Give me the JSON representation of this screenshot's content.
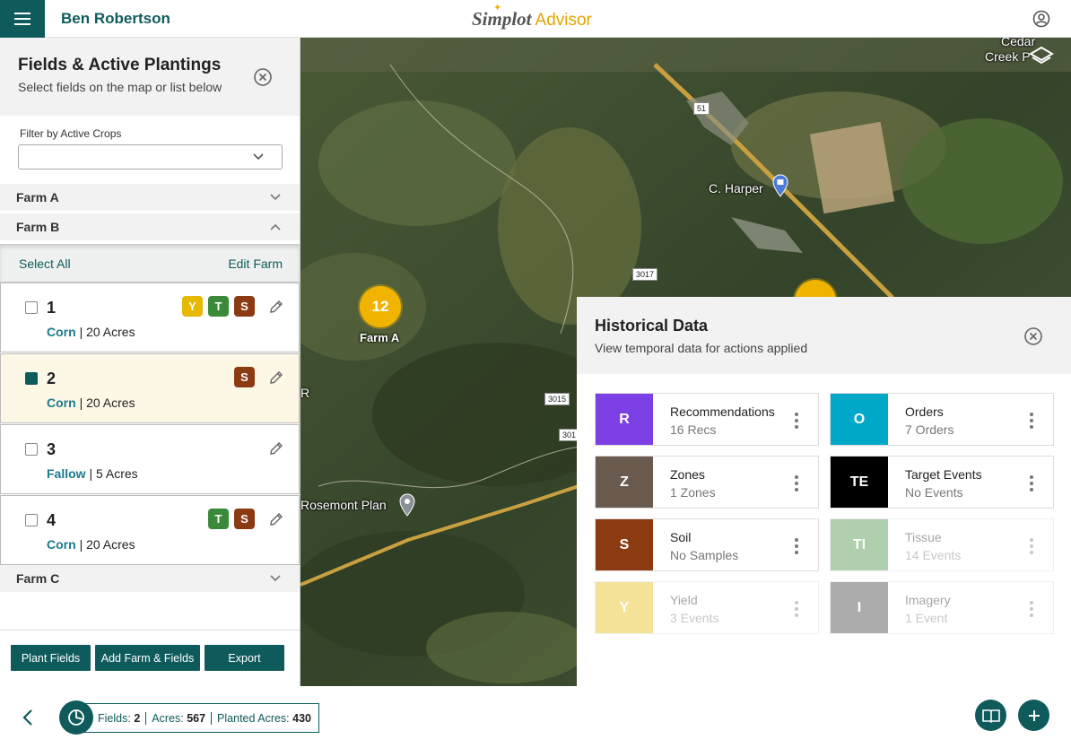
{
  "app": {
    "user_name": "Ben Robertson",
    "brand_name": "Simplot",
    "brand_product": "Advisor",
    "colors": {
      "primary": "#0f5b5c",
      "accent": "#f0b400"
    }
  },
  "fields_panel": {
    "title": "Fields & Active Plantings",
    "subtitle": "Select fields on the map or list below",
    "filter_label": "Filter by Active Crops",
    "filter_value": "",
    "farms": {
      "a": "Farm A",
      "b": "Farm B",
      "c": "Farm C"
    },
    "select_all": "Select All",
    "edit_farm": "Edit Farm",
    "fields": [
      {
        "number": "1",
        "crop": "Corn",
        "acres": "20 Acres",
        "checked": false,
        "badges": [
          "Y",
          "T",
          "S"
        ]
      },
      {
        "number": "2",
        "crop": "Corn",
        "acres": "20 Acres",
        "checked": true,
        "badges": [
          "S"
        ]
      },
      {
        "number": "3",
        "crop": "Fallow",
        "acres": "5 Acres",
        "checked": false,
        "badges": []
      },
      {
        "number": "4",
        "crop": "Corn",
        "acres": "20 Acres",
        "checked": false,
        "badges": [
          "T",
          "S"
        ]
      }
    ],
    "separator": "|",
    "buttons": {
      "plant": "Plant Fields",
      "add": "Add Farm & Fields",
      "export": "Export"
    }
  },
  "map": {
    "cluster_count": "12",
    "cluster_label": "Farm A",
    "places": {
      "harper": "C. Harper",
      "rosemont": "Rosemont Plan",
      "cedar": "Cedar",
      "creek": "Creek P"
    },
    "routes": [
      "51",
      "3017",
      "3015",
      "301"
    ],
    "edge_letter": "R"
  },
  "historical": {
    "title": "Historical Data",
    "subtitle": "View temporal data for actions applied",
    "cards": [
      {
        "letter": "R",
        "title": "Recommendations",
        "sub": "16 Recs",
        "color": "#7b3fe4",
        "enabled": true
      },
      {
        "letter": "O",
        "title": "Orders",
        "sub": "7 Orders",
        "color": "#00a8c8",
        "enabled": true
      },
      {
        "letter": "Z",
        "title": "Zones",
        "sub": "1 Zones",
        "color": "#6b5a4e",
        "enabled": true
      },
      {
        "letter": "TE",
        "title": "Target Events",
        "sub": "No Events",
        "color": "#000000",
        "enabled": true
      },
      {
        "letter": "S",
        "title": "Soil",
        "sub": "No Samples",
        "color": "#8b3a12",
        "enabled": true
      },
      {
        "letter": "TI",
        "title": "Tissue",
        "sub": "14 Events",
        "color": "#3a8a3a",
        "enabled": false
      },
      {
        "letter": "Y",
        "title": "Yield",
        "sub": "3 Events",
        "color": "#e6b800",
        "enabled": false
      },
      {
        "letter": "I",
        "title": "Imagery",
        "sub": "1 Event",
        "color": "#333333",
        "enabled": false
      }
    ]
  },
  "stats": {
    "fields_label": "Fields:",
    "fields_value": "2",
    "acres_label": "Acres:",
    "acres_value": "567",
    "planted_label": "Planted Acres:",
    "planted_value": "430"
  },
  "icons": {
    "menu": "menu-icon",
    "account": "account-icon",
    "layers": "layers-icon",
    "close": "close-icon",
    "chevron": "chevron-icon",
    "pencil": "pencil-icon",
    "pie": "pie-chart-icon",
    "book": "book-icon",
    "plus": "plus-icon"
  }
}
